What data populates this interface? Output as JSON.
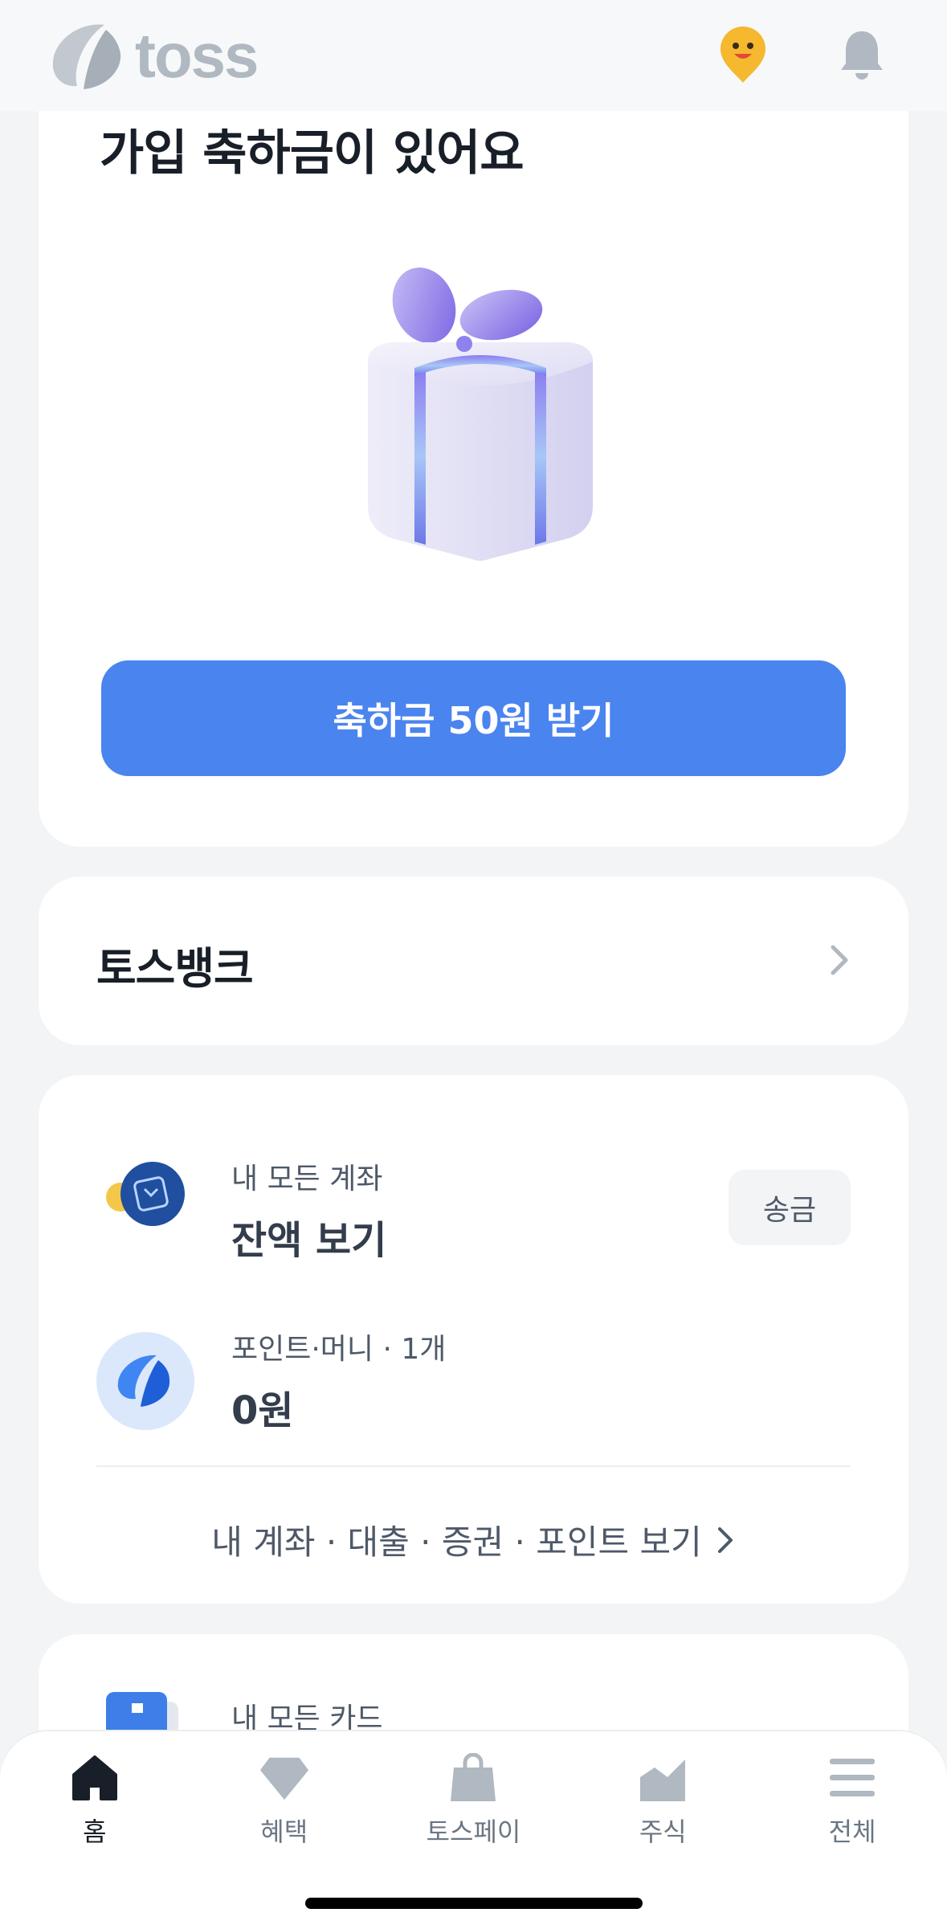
{
  "header": {
    "brand": "toss",
    "icons": [
      "toss-logo-icon",
      "face-marker-icon",
      "bell-icon"
    ]
  },
  "gift_card": {
    "title": "가입 축하금이 있어요",
    "cta_label": "축하금 50원 받기"
  },
  "bank_card": {
    "title": "토스뱅크"
  },
  "accounts_card": {
    "rows": [
      {
        "subtitle": "내 모든 계좌",
        "main": "잔액 보기",
        "action": "송금"
      },
      {
        "subtitle": "포인트·머니 · 1개",
        "main": "0원"
      }
    ],
    "more_link": "내 계좌 · 대출 · 증권 · 포인트 보기"
  },
  "cards_card": {
    "subtitle": "내 모든 카드"
  },
  "bottom_nav": {
    "items": [
      {
        "label": "홈",
        "icon": "home-icon",
        "active": true
      },
      {
        "label": "혜택",
        "icon": "diamond-icon",
        "active": false
      },
      {
        "label": "토스페이",
        "icon": "shopping-bag-icon",
        "active": false
      },
      {
        "label": "주식",
        "icon": "chart-icon",
        "active": false
      },
      {
        "label": "전체",
        "icon": "menu-icon",
        "active": false
      }
    ]
  },
  "colors": {
    "primary": "#4a84ee",
    "background": "#f2f4f6",
    "card": "#ffffff",
    "text_primary": "#191f28",
    "text_secondary": "#4e5968",
    "icon_gray": "#b0b8c1"
  }
}
